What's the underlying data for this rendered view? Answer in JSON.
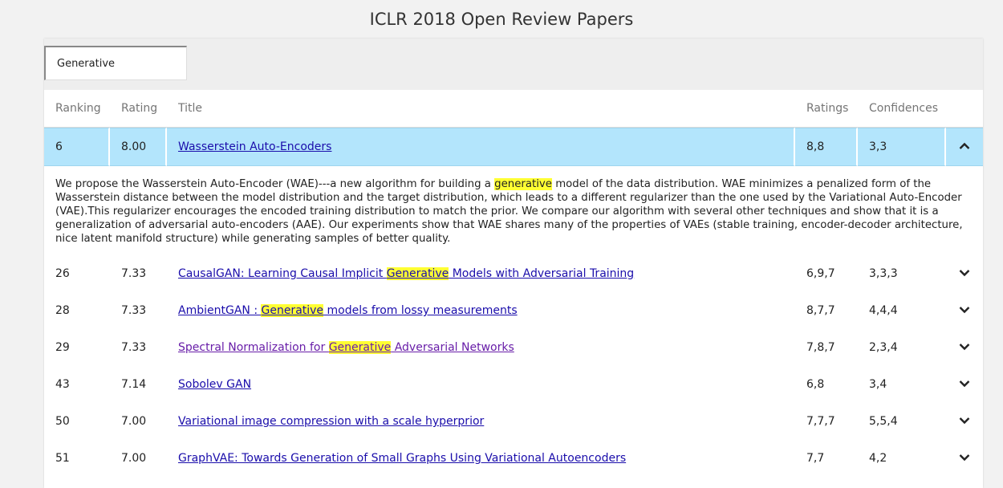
{
  "page": {
    "title": "ICLR 2018 Open Review Papers"
  },
  "search": {
    "value": "Generative"
  },
  "table": {
    "headers": {
      "ranking": "Ranking",
      "rating": "Rating",
      "title": "Title",
      "ratings": "Ratings",
      "confidences": "Confidences"
    },
    "highlight_term": "generative",
    "expanded_row": {
      "ranking": "6",
      "rating": "8.00",
      "title": "Wasserstein Auto-Encoders",
      "ratings": "8,8",
      "confidences": "3,3",
      "abstract_before": "We propose the Wasserstein Auto-Encoder (WAE)---a new algorithm for building a ",
      "abstract_highlight": "generative",
      "abstract_after": " model of the data distribution. WAE minimizes a penalized form of the Wasserstein distance between the model distribution and the target distribution, which leads to a different regularizer than the one used by the Variational Auto-Encoder (VAE).This regularizer encourages the encoded training distribution to match the prior. We compare our algorithm with several other techniques and show that it is a generalization of adversarial auto-encoders (AAE). Our experiments show that WAE shares many of the properties of VAEs (stable training, encoder-decoder architecture, nice latent manifold structure) while generating samples of better quality."
    },
    "rows": [
      {
        "ranking": "26",
        "rating": "7.33",
        "title_before": "CausalGAN: Learning Causal Implicit ",
        "title_hl": "Generative",
        "title_after": " Models with Adversarial Training",
        "ratings": "6,9,7",
        "confidences": "3,3,3"
      },
      {
        "ranking": "28",
        "rating": "7.33",
        "title_before": "AmbientGAN : ",
        "title_hl": "Generative",
        "title_after": " models from lossy measurements",
        "ratings": "8,7,7",
        "confidences": "4,4,4"
      },
      {
        "ranking": "29",
        "rating": "7.33",
        "title_before": "Spectral Normalization for ",
        "title_hl": "Generative",
        "title_after": " Adversarial Networks",
        "ratings": "7,8,7",
        "confidences": "2,3,4"
      },
      {
        "ranking": "43",
        "rating": "7.14",
        "title_before": "Sobolev GAN",
        "title_hl": "",
        "title_after": "",
        "ratings": "6,8",
        "confidences": "3,4"
      },
      {
        "ranking": "50",
        "rating": "7.00",
        "title_before": "Variational image compression with a scale hyperprior",
        "title_hl": "",
        "title_after": "",
        "ratings": "7,7,7",
        "confidences": "5,5,4"
      },
      {
        "ranking": "51",
        "rating": "7.00",
        "title_before": "GraphVAE: Towards Generation of Small Graphs Using Variational Autoencoders",
        "title_hl": "",
        "title_after": "",
        "ratings": "7,7",
        "confidences": "4,2"
      }
    ]
  }
}
